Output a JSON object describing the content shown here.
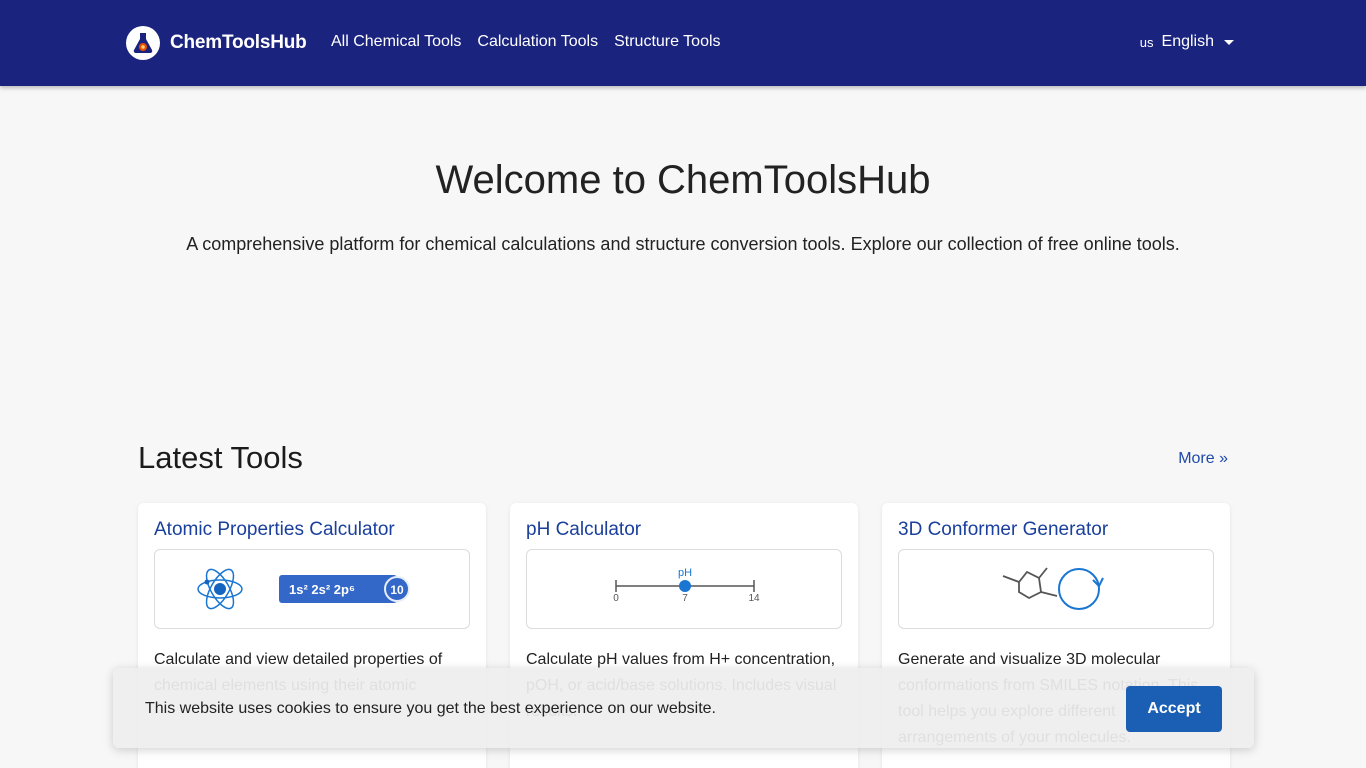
{
  "navbar": {
    "brand": "ChemToolsHub",
    "links": [
      "All Chemical Tools",
      "Calculation Tools",
      "Structure Tools"
    ],
    "language": {
      "code": "us",
      "label": "English"
    }
  },
  "hero": {
    "title": "Welcome to ChemToolsHub",
    "subtitle": "A comprehensive platform for chemical calculations and structure conversion tools. Explore our collection of free online tools."
  },
  "latest": {
    "title": "Latest Tools",
    "more": "More »"
  },
  "cards": [
    {
      "title": "Atomic Properties Calculator",
      "preview": {
        "config": "1s² 2s² 2p⁶",
        "number": "10"
      },
      "description": "Calculate and view detailed properties of chemical elements using their atomic"
    },
    {
      "title": "pH Calculator",
      "preview": {
        "label": "pH",
        "min": "0",
        "mid": "7",
        "max": "14"
      },
      "description": "Calculate pH values from H+ concentration, pOH, or acid/base solutions. Includes visual results."
    },
    {
      "title": "3D Conformer Generator",
      "description": "Generate and visualize 3D molecular conformations from SMILES notation. This tool helps you explore different arrangements of your molecules."
    }
  ],
  "cookie": {
    "text": "This website uses cookies to ensure you get the best experience on our website.",
    "accept": "Accept"
  },
  "colors": {
    "navbar": "#1a237e",
    "link": "#1a3f9c",
    "accent": "#1a5fb4",
    "atom_icon": "#1976d2",
    "config_badge": "#3367c8"
  }
}
